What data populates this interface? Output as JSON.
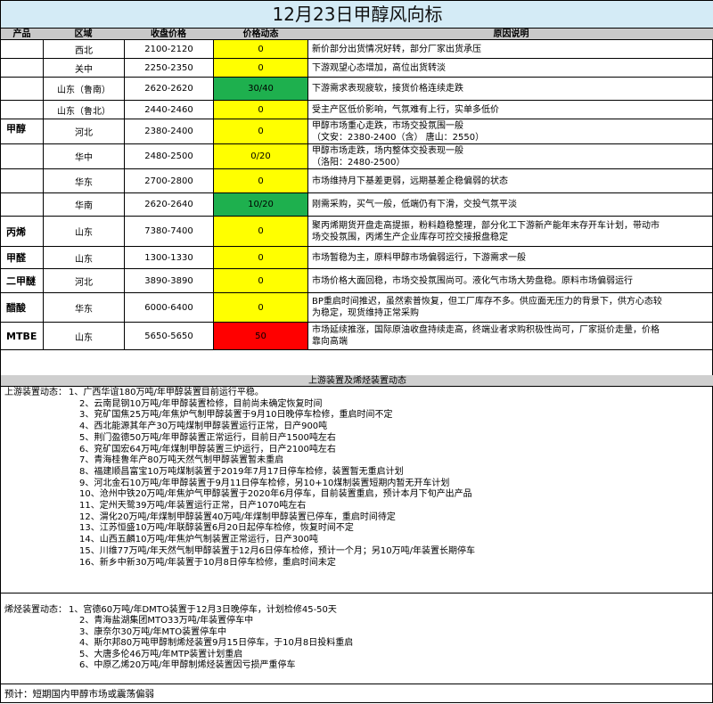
{
  "title": "12月23日甲醇风向标",
  "headers": {
    "product": "产品",
    "region": "区域",
    "price": "收盘价格",
    "trend": "价格动态",
    "reason": "原因说明"
  },
  "products": [
    {
      "name": "甲醇",
      "rows": [
        {
          "region": "西北",
          "price": "2100-2120",
          "trend": "0",
          "color": "yellow",
          "reason": [
            "新价部分出货情况好转，部分厂家出货承压"
          ]
        },
        {
          "region": "关中",
          "price": "2250-2350",
          "trend": "0",
          "color": "yellow",
          "reason": [
            "下游观望心态增加，高位出货转淡"
          ]
        },
        {
          "region": "山东（鲁南）",
          "price": "2620-2620",
          "trend": "30/40",
          "color": "green",
          "reason": [
            "下游需求表现疲软，接货价格连续走跌"
          ]
        },
        {
          "region": "山东（鲁北）",
          "price": "2440-2460",
          "trend": "0",
          "color": "yellow",
          "reason": [
            "受主产区低价影响，气氛难有上行，实单多低价"
          ]
        },
        {
          "region": "河北",
          "price": "2380-2400",
          "trend": "0",
          "color": "yellow",
          "reason": [
            "甲醇市场重心走跌，市场交投氛围一般",
            "（文安：2380-2400（含） 唐山：2550）"
          ]
        },
        {
          "region": "华中",
          "price": "2480-2500",
          "trend": "0/20",
          "color": "yellow",
          "reason": [
            "甲醇市场走跌，场内整体交投表现一般",
            "（洛阳：2480-2500）"
          ]
        },
        {
          "region": "华东",
          "price": "2700-2800",
          "trend": "0",
          "color": "yellow",
          "reason": [
            "市场维持月下基差更弱，远期基差企稳偏弱的状态"
          ]
        },
        {
          "region": "华南",
          "price": "2620-2640",
          "trend": "10/20",
          "color": "green",
          "reason": [
            "刚需采购，买气一般，低端仍有下滑，交投气氛平淡"
          ]
        }
      ]
    },
    {
      "name": "丙烯",
      "rows": [
        {
          "region": "山东",
          "price": "7380-7400",
          "trend": "0",
          "color": "yellow",
          "reason": [
            "聚丙烯期货开盘走高提振，粉料趋稳整理，部分化工下游新产能年末存开车计划，带动市",
            "场交投氛围，丙烯生产企业库存可控交接报盘稳定"
          ]
        }
      ]
    },
    {
      "name": "甲醛",
      "rows": [
        {
          "region": "山东",
          "price": "1300-1330",
          "trend": "0",
          "color": "yellow",
          "reason": [
            "市场暂稳为主，原料甲醇市场偏弱运行，下游需求一般"
          ]
        }
      ]
    },
    {
      "name": "二甲醚",
      "rows": [
        {
          "region": "河北",
          "price": "3890-3890",
          "trend": "0",
          "color": "yellow",
          "reason": [
            "市场价格大面回稳，市场交投氛围尚可。液化气市场大势盘稳。原料市场偏弱运行"
          ]
        }
      ]
    },
    {
      "name": "醋酸",
      "rows": [
        {
          "region": "华东",
          "price": "6000-6400",
          "trend": "0",
          "color": "yellow",
          "reason": [
            "BP重启时间推迟，虽然索普恢复，但工厂库存不多。供应面无压力的背景下，供方心态较",
            "为稳定，现货维持正常采购"
          ]
        }
      ]
    },
    {
      "name": "MTBE",
      "rows": [
        {
          "region": "山东",
          "price": "5650-5650",
          "trend": "50",
          "color": "red",
          "reason": [
            "市场延续推涨，国际原油收盘持续走高，终端业者求购积极性尚可，厂家挺价走量，价格",
            "靠向高端"
          ]
        }
      ]
    }
  ],
  "section_bar": "上游装置及烯烃装置动态",
  "upstream": {
    "label": "上游装置动态：",
    "items": [
      "1、广西华谊180万吨/年甲醇装置目前运行平稳。",
      "2、云南昆钢10万吨/年甲醇装置检修，目前尚未确定恢复时间",
      "3、兖矿国焦25万吨/年焦炉气制甲醇装置于9月10日晚停车检修，重启时间不定",
      "4、西北能源其年产30万吨煤制甲醇装置运行正常，日产900吨",
      "5、荆门盈德50万吨/年甲醇装置正常运行，目前日产1500吨左右",
      "6、兖矿国宏64万吨/年煤制甲醇装置三炉运行，日产2100吨左右",
      "7、青海桂鲁年产80万吨天然气制甲醇装置暂未重启",
      "8、福建顺昌富宝10万吨煤制装置于2019年7月17日停车检修，装置暂无重启计划",
      "9、河北金石10万吨/年甲醇装置于9月11日停车检修，另10+10煤制装置短期内暂无开车计划",
      "10、沧州中铁20万吨/年焦炉气甲醇装置于2020年6月停车，目前装置重启，预计本月下旬产出产品",
      "11、定州天鹭39万吨/年装置运行正常，日产1070吨左右",
      "12、渭化20万吨/年煤制甲醇装置40万吨/年煤制甲醇装置已停车，重启时间待定",
      "13、江苏恒盛10万吨/年联醇装置6月20日起停车检修，恢复时间不定",
      "14、山西五麟10万吨/年焦炉气制装置正常运行，日产300吨",
      "15、川维77万吨/年天然气制甲醇装置于12月6日停车检修，预计一个月；另10万吨/年装置长期停车",
      "16、新乡中新30万吨/年装置于10月8日停车检修，重启时间未定"
    ]
  },
  "olefin": {
    "label": "烯烃装置动态：",
    "items": [
      "1、宫德60万吨/年DMTO装置于12月3日晚停车，计划检修45-50天",
      "2、青海盐湖集团MTO33万吨/年装置停车中",
      "3、康奈尔30万吨/年MTO装置停车中",
      "4、斯尔邦80万吨甲醇制烯烃装置9月15日停车，于10月8日投料重启",
      "5、大唐多伦46万吨/年MTP装置计划重启",
      "6、中原乙烯20万吨/年甲醇制烯烃装置因亏损严重停车"
    ]
  },
  "forecast": "预计：短期国内甲醇市场或震荡偏弱"
}
